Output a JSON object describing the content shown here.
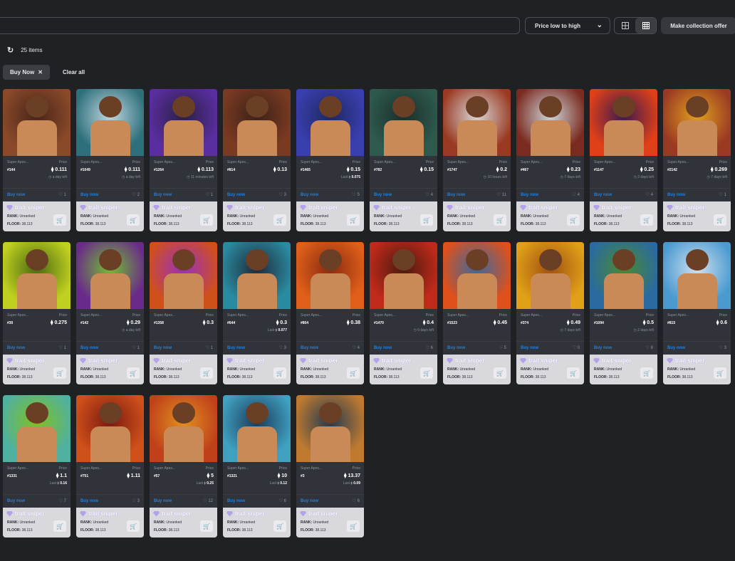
{
  "toolbar": {
    "sort_label": "Price low to high",
    "collection_offer_label": "Make collection offer"
  },
  "results": {
    "count": "25 items"
  },
  "filters": {
    "chip_label": "Buy Now",
    "clear_label": "Clear all"
  },
  "labels": {
    "collection": "Super Apes...",
    "price": "Price",
    "buy_now": "Buy now",
    "last": "Last",
    "sniper_title": "trait sniper",
    "rank_label": "RANK:",
    "rank_value": "Unranked",
    "floor_label": "FLOOR:",
    "floor_value": "38.113"
  },
  "colors": {
    "background": "#202124",
    "card": "#303339",
    "link": "#2081e2",
    "sniper": "#d9d9dd"
  },
  "items": [
    {
      "token": "#144",
      "price": "0.111",
      "sub": "a day left",
      "last": "",
      "favs": "1",
      "c1": "#8a4a2a",
      "c2": "#4a2418"
    },
    {
      "token": "#1049",
      "price": "0.111",
      "sub": "a day left",
      "last": "",
      "favs": "2",
      "c1": "#2d6f7a",
      "c2": "#c0d6e0"
    },
    {
      "token": "#1264",
      "price": "0.113",
      "sub": "11 minutes left",
      "last": "",
      "favs": "1",
      "c1": "#5a2ea0",
      "c2": "#2a2046"
    },
    {
      "token": "#814",
      "price": "0.13",
      "sub": "",
      "last": "",
      "favs": "3",
      "c1": "#7a3a22",
      "c2": "#3c2218"
    },
    {
      "token": "#1465",
      "price": "0.15",
      "sub": "",
      "last": "0.075",
      "favs": "5",
      "c1": "#3a3fb0",
      "c2": "#1e2860"
    },
    {
      "token": "#782",
      "price": "0.15",
      "sub": "",
      "last": "",
      "favs": "4",
      "c1": "#2e5a4e",
      "c2": "#1a2e2a"
    },
    {
      "token": "#1747",
      "price": "0.2",
      "sub": "10 hours left",
      "last": "",
      "favs": "11",
      "c1": "#9a3a22",
      "c2": "#d8d8d8"
    },
    {
      "token": "#467",
      "price": "0.23",
      "sub": "7 days left",
      "last": "",
      "favs": "4",
      "c1": "#7a2a1e",
      "c2": "#cfd6dc"
    },
    {
      "token": "#1147",
      "price": "0.25",
      "sub": "2 days left",
      "last": "",
      "favs": "4",
      "c1": "#e04018",
      "c2": "#3a1a50"
    },
    {
      "token": "#2142",
      "price": "0.269",
      "sub": "7 days left",
      "last": "",
      "favs": "1",
      "c1": "#9a3a22",
      "c2": "#e0a020"
    },
    {
      "token": "#30",
      "price": "0.275",
      "sub": "",
      "last": "",
      "favs": "1",
      "c1": "#c0d020",
      "c2": "#4a6a10"
    },
    {
      "token": "#142",
      "price": "0.29",
      "sub": "a day left",
      "last": "",
      "favs": "1",
      "c1": "#6a2a8a",
      "c2": "#70c030"
    },
    {
      "token": "#1358",
      "price": "0.3",
      "sub": "",
      "last": "",
      "favs": "1",
      "c1": "#d0501a",
      "c2": "#9a30c0"
    },
    {
      "token": "#644",
      "price": "0.3",
      "sub": "",
      "last": "0.077",
      "favs": "3",
      "c1": "#2a8aa0",
      "c2": "#1e2a3a"
    },
    {
      "token": "#804",
      "price": "0.38",
      "sub": "",
      "last": "",
      "favs": "4",
      "c1": "#e0601a",
      "c2": "#8a2a10"
    },
    {
      "token": "#1470",
      "price": "0.4",
      "sub": "6 days left",
      "last": "",
      "favs": "6",
      "c1": "#c02a1a",
      "c2": "#4a1a10"
    },
    {
      "token": "#1523",
      "price": "0.45",
      "sub": "",
      "last": "",
      "favs": "5",
      "c1": "#e0501a",
      "c2": "#3a6aa0"
    },
    {
      "token": "#374",
      "price": "0.49",
      "sub": "7 days left",
      "last": "",
      "favs": "0",
      "c1": "#e0a018",
      "c2": "#a05010"
    },
    {
      "token": "#1094",
      "price": "0.5",
      "sub": "2 days left",
      "last": "",
      "favs": "8",
      "c1": "#2a6aa0",
      "c2": "#4a8a30"
    },
    {
      "token": "#815",
      "price": "0.6",
      "sub": "",
      "last": "",
      "favs": "3",
      "c1": "#4a9ad0",
      "c2": "#d0e0f0"
    },
    {
      "token": "#1331",
      "price": "1.1",
      "sub": "",
      "last": "0.16",
      "favs": "7",
      "c1": "#50b0a0",
      "c2": "#80c020"
    },
    {
      "token": "#751",
      "price": "1.11",
      "sub": "",
      "last": "",
      "favs": "3",
      "c1": "#d0501a",
      "c2": "#7a1a10"
    },
    {
      "token": "#57",
      "price": "5",
      "sub": "",
      "last": "0.25",
      "favs": "12",
      "c1": "#c0401a",
      "c2": "#e09020"
    },
    {
      "token": "#1321",
      "price": "10",
      "sub": "",
      "last": "0.12",
      "favs": "6",
      "c1": "#40a0c0",
      "c2": "#1a3a5a"
    },
    {
      "token": "#3",
      "price": "13.37",
      "sub": "",
      "last": "0.09",
      "favs": "6",
      "c1": "#c07a30",
      "c2": "#203a50"
    }
  ]
}
